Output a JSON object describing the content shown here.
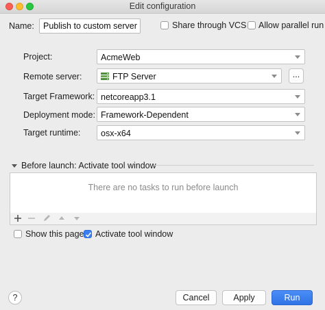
{
  "window": {
    "title": "Edit configuration"
  },
  "name_row": {
    "label": "Name:",
    "value": "Publish to custom server",
    "share_label": "Share through VCS",
    "share_checked": false,
    "parallel_label": "Allow parallel run",
    "parallel_checked": false
  },
  "fields": {
    "project": {
      "label": "Project:",
      "value": "AcmeWeb"
    },
    "remote_server": {
      "label": "Remote server:",
      "value": "FTP Server",
      "browse_label": "..."
    },
    "target_framework": {
      "label": "Target Framework:",
      "value": "netcoreapp3.1"
    },
    "deployment_mode": {
      "label": "Deployment mode:",
      "value": "Framework-Dependent"
    },
    "target_runtime": {
      "label": "Target runtime:",
      "value": "osx-x64"
    }
  },
  "before_launch": {
    "title": "Before launch: Activate tool window",
    "empty_text": "There are no tasks to run before launch"
  },
  "options": {
    "show_page_label": "Show this page",
    "show_page_checked": false,
    "activate_label": "Activate tool window",
    "activate_checked": true
  },
  "buttons": {
    "help": "?",
    "cancel": "Cancel",
    "apply": "Apply",
    "run": "Run"
  },
  "colors": {
    "accent": "#3b7ff0",
    "background": "#ececec"
  }
}
